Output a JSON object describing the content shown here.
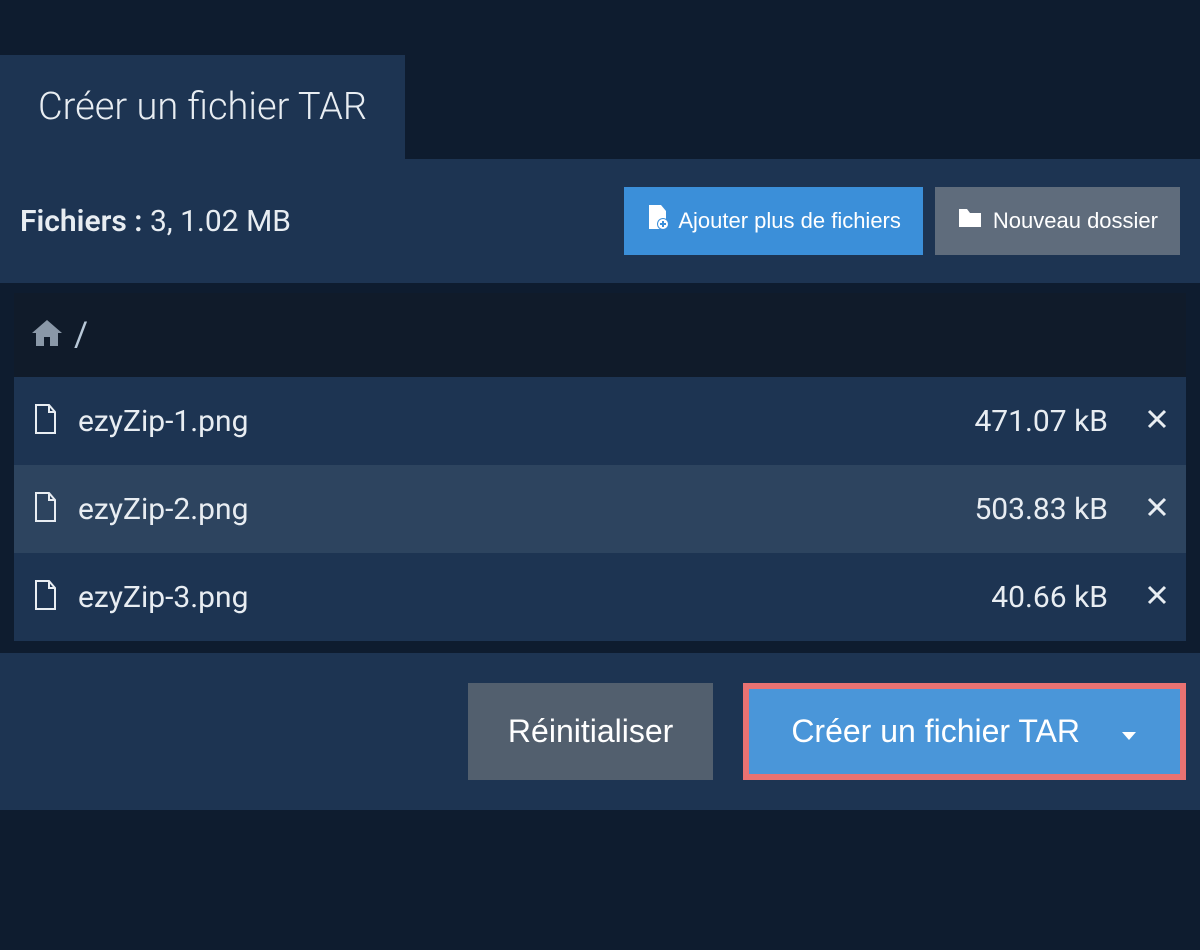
{
  "tab": {
    "title": "Créer un fichier TAR"
  },
  "toolbar": {
    "files_label": "Fichiers :",
    "files_summary": "3, 1.02 MB",
    "add_files_label": "Ajouter plus de fichiers",
    "new_folder_label": "Nouveau dossier"
  },
  "breadcrumb": {
    "path": "/"
  },
  "files": [
    {
      "name": "ezyZip-1.png",
      "size": "471.07 kB"
    },
    {
      "name": "ezyZip-2.png",
      "size": "503.83 kB"
    },
    {
      "name": "ezyZip-3.png",
      "size": "40.66 kB"
    }
  ],
  "footer": {
    "reset_label": "Réinitialiser",
    "create_label": "Créer un fichier TAR"
  }
}
